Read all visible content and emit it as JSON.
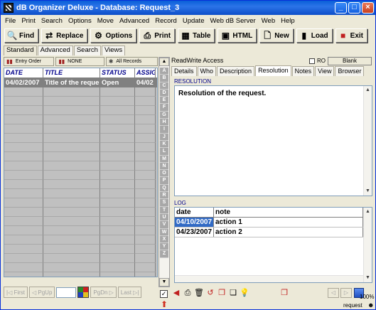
{
  "window": {
    "title": "dB Organizer Deluxe - Database: Request_3"
  },
  "menu": [
    "File",
    "Print",
    "Search",
    "Options",
    "Move",
    "Advanced",
    "Record",
    "Update",
    "Web dB Server",
    "Web",
    "Help"
  ],
  "toolbar": [
    {
      "label": "Find",
      "icon": "find-icon"
    },
    {
      "label": "Replace",
      "icon": "replace-icon"
    },
    {
      "label": "Options",
      "icon": "options-icon"
    },
    {
      "label": "Print",
      "icon": "printer-icon"
    },
    {
      "label": "Table",
      "icon": "table-icon"
    },
    {
      "label": "HTML",
      "icon": "html-icon"
    },
    {
      "label": "New",
      "icon": "new-icon"
    },
    {
      "label": "Load",
      "icon": "load-icon"
    },
    {
      "label": "Exit",
      "icon": "exit-icon"
    }
  ],
  "view_tabs": [
    "Standard",
    "Advanced",
    "Search",
    "Views"
  ],
  "sort_buttons": [
    "Entry Order",
    "NONE",
    "All Records"
  ],
  "list": {
    "columns": [
      "DATE",
      "TITLE",
      "STATUS",
      "ASSIG"
    ],
    "rows": [
      {
        "date": "04/02/2007",
        "title": "Title of the reque",
        "status": "Open",
        "assig": "04/02"
      }
    ]
  },
  "alphabet": [
    "A",
    "B",
    "C",
    "D",
    "E",
    "F",
    "G",
    "H",
    "I",
    "J",
    "K",
    "L",
    "M",
    "N",
    "O",
    "P",
    "Q",
    "R",
    "S",
    "T",
    "U",
    "V",
    "W",
    "X",
    "Y",
    "Z"
  ],
  "pager": {
    "first": "First",
    "pgup": "PgUp",
    "pgdn": "PgDn",
    "last": "Last"
  },
  "record": {
    "access": "ReadWrite Access",
    "ro_label": "RO",
    "blank_button": "Blank",
    "tabs": [
      "Details",
      "Who",
      "Description",
      "Resolution",
      "Notes",
      "View",
      "Browser"
    ],
    "active_tab": "Resolution",
    "resolution_label": "RESOLUTION",
    "resolution_text": "Resolution of the request.",
    "log_label": "LOG",
    "log_columns": [
      "date",
      "note"
    ],
    "log_rows": [
      {
        "date": "04/10/2007",
        "note": "action 1"
      },
      {
        "date": "04/23/2007",
        "note": "action 2"
      }
    ]
  },
  "status": {
    "zoom": "100%",
    "label": "request"
  }
}
